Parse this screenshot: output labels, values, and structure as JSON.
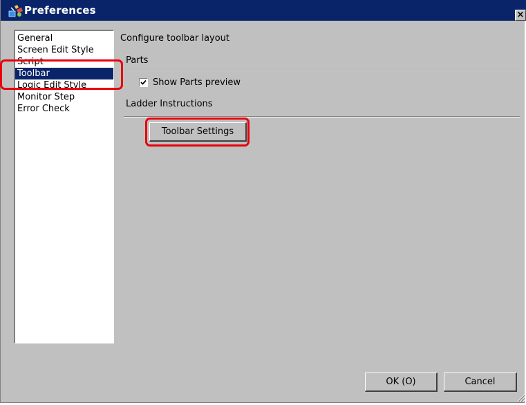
{
  "window": {
    "title": "Preferences",
    "close_glyph": "×"
  },
  "category_list": {
    "items": [
      {
        "label": "General",
        "selected": false
      },
      {
        "label": "Screen Edit Style",
        "selected": false
      },
      {
        "label": "Script",
        "selected": false
      },
      {
        "label": "Toolbar",
        "selected": true
      },
      {
        "label": "Logic Edit Style",
        "selected": false
      },
      {
        "label": "Monitor Step",
        "selected": false
      },
      {
        "label": "Error Check",
        "selected": false
      }
    ]
  },
  "panel": {
    "heading": "Configure toolbar layout",
    "parts_section": "Parts",
    "show_parts_preview": {
      "label": "Show Parts preview",
      "checked": true
    },
    "ladder_section": "Ladder Instructions",
    "toolbar_settings_button": "Toolbar Settings"
  },
  "footer": {
    "ok_label": "OK (O)",
    "cancel_label": "Cancel"
  },
  "colors": {
    "title_bar": "#0a246a",
    "selection": "#0a246a",
    "dialog_face": "#c0c0c0",
    "highlight_annotation": "#e8000b"
  },
  "icons": {
    "app": "preferences-app-icon",
    "close": "close-icon",
    "check": "checkmark-icon",
    "grip": "resize-grip-icon"
  }
}
